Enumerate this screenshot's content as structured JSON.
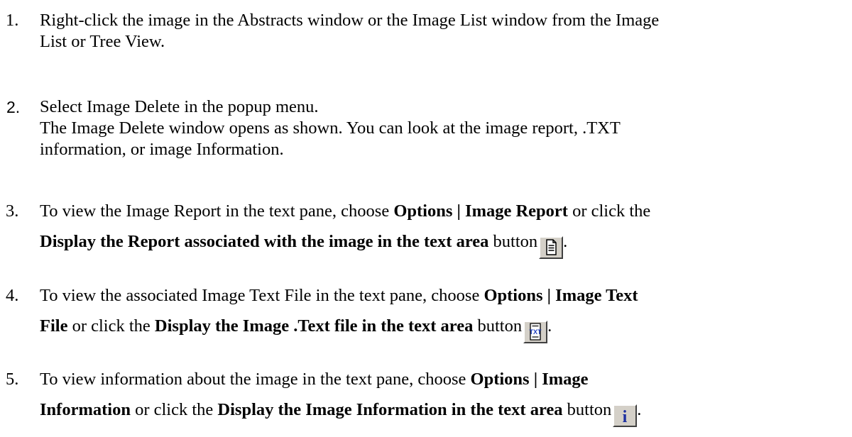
{
  "steps": [
    {
      "number": "1.",
      "lines": [
        "Right-click the image in the Abstracts window or the Image List window from the Image",
        "List or Tree View."
      ]
    },
    {
      "number": "2.",
      "lines": [
        "Select Image Delete in the popup menu.",
        "The Image Delete window opens as shown. You can look at the image report, .TXT",
        "information, or image Information."
      ]
    },
    {
      "number": "3.",
      "line1_pre": "To view the Image Report in the text pane, choose ",
      "line1_bold": "Options | Image Report",
      "line1_post": " or click the",
      "line2_bold": "Display the Report associated with the image in the text area",
      "line2_post": " button",
      "button_icon": "report-icon"
    },
    {
      "number": "4.",
      "line1_pre": "To view the associated Image Text File in the text pane, choose ",
      "line1_bold": "Options | Image Text",
      "line2_bold_a": "File",
      "line2_mid": " or click the ",
      "line2_bold_b": "Display the Image .Text file in the text area",
      "line2_post": " button",
      "button_icon": "txt-file-icon",
      "button_text": "TXT"
    },
    {
      "number": "5.",
      "line1_pre": "To view information about the image in the text pane, choose ",
      "line1_bold": "Options | Image",
      "line2_bold_a": "Information",
      "line2_mid": " or click the ",
      "line2_bold_b": "Display the Image Information in the text area",
      "line2_post": " button",
      "button_icon": "info-icon",
      "button_text": "i"
    }
  ],
  "trailing_period": "."
}
